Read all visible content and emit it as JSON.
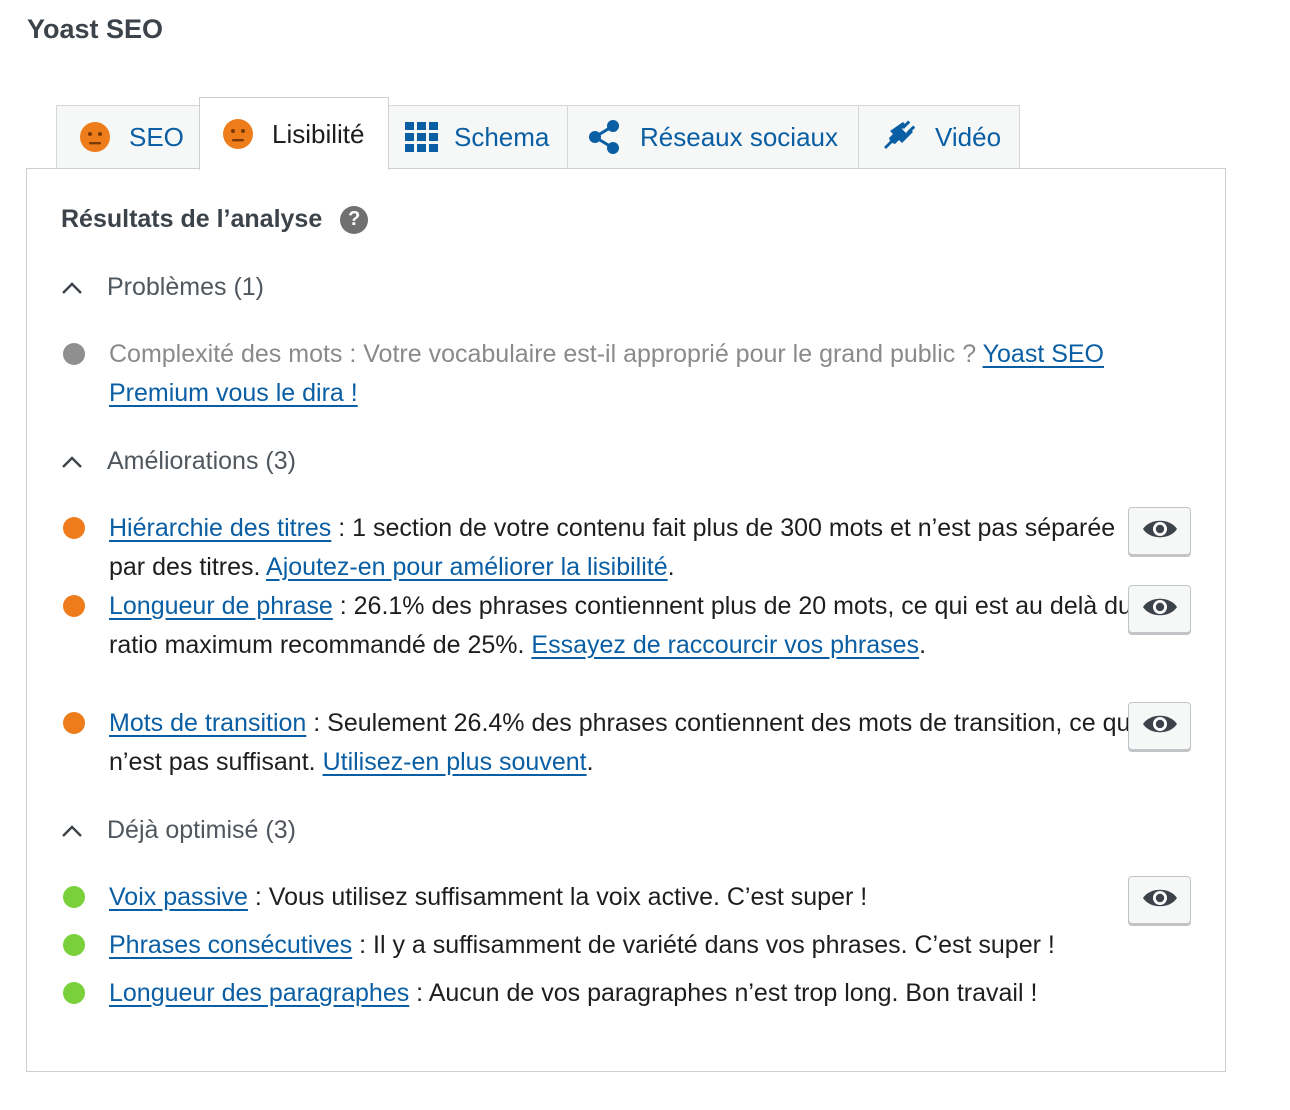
{
  "app": {
    "title": "Yoast SEO"
  },
  "tabs": [
    {
      "label": "SEO",
      "icon": "neutral-face-icon",
      "active": false
    },
    {
      "label": "Lisibilité",
      "icon": "neutral-face-icon",
      "active": true
    },
    {
      "label": "Schema",
      "icon": "grid-icon",
      "active": false
    },
    {
      "label": "Réseaux sociaux",
      "icon": "share-icon",
      "active": false
    },
    {
      "label": "Vidéo",
      "icon": "video-plug-icon",
      "active": false
    }
  ],
  "analysis": {
    "title": "Résultats de l’analyse",
    "help_icon": "?",
    "groups": {
      "problems": {
        "label": "Problèmes (1)",
        "items": [
          {
            "text": "Complexité des mots : Votre vocabulaire est-il approprié pour le grand public ? ",
            "link": "Yoast SEO Premium vous le dira !"
          }
        ]
      },
      "improvements": {
        "label": "Améliorations (3)",
        "items": [
          {
            "link": "Hiérarchie des titres",
            "text": " : 1 section de votre contenu fait plus de 300 mots et n’est pas séparée par des titres. ",
            "link2": "Ajoutez-en pour améliorer la lisibilité",
            "end": "."
          },
          {
            "link": "Longueur de phrase",
            "text": " : 26.1% des phrases contiennent plus de 20 mots, ce qui est au delà du ratio maximum recommandé de 25%. ",
            "link2": "Essayez de raccourcir vos phrases",
            "end": "."
          },
          {
            "link": "Mots de transition",
            "text": " : Seulement 26.4% des phrases contiennent des mots de transition, ce qui n’est pas suffisant. ",
            "link2": "Utilisez-en plus souvent",
            "end": "."
          }
        ]
      },
      "good": {
        "label": "Déjà optimisé (3)",
        "items": [
          {
            "link": "Voix passive",
            "text": " : Vous utilisez suffisamment la voix active. C’est super !"
          },
          {
            "link": "Phrases consécutives",
            "text": " : Il y a suffisamment de variété dans vos phrases. C’est super !"
          },
          {
            "link": "Longueur des paragraphes",
            "text": " : Aucun de vos paragraphes n’est trop long. Bon travail !"
          }
        ]
      }
    }
  },
  "colors": {
    "problem": "#8f8f8f",
    "improvement": "#ee7c1b",
    "good": "#7ad03a",
    "link": "#0a5ea3",
    "tab_face": "#ee7c1b"
  }
}
